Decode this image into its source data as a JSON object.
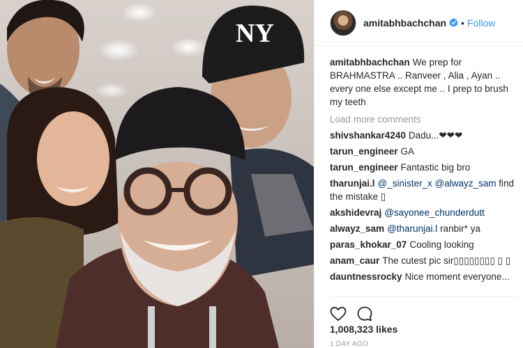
{
  "post": {
    "username": "amitabhbachchan",
    "separator": "•",
    "follow_label": "Follow",
    "caption_text": "We prep for BRAHMASTRA .. Ranveer , Alia , Ayan .. every one else except me .. I prep to brush my teeth",
    "load_more_label": "Load more comments",
    "likes": "1,008,323 likes",
    "date": "1 DAY AGO"
  },
  "comments": [
    {
      "user": "shivshankar4240",
      "text": "Dadu...❤❤❤"
    },
    {
      "user": "tarun_engineer",
      "text": "GA"
    },
    {
      "user": "tarun_engineer",
      "text": "Fantastic big bro"
    },
    {
      "user": "tharunjai.l",
      "mention": "@_sinister_x @alwayz_sam",
      "text": " find the mistake ▯"
    },
    {
      "user": "akshidevraj",
      "mention": "@sayonee_chunderdutt",
      "text": ""
    },
    {
      "user": "alwayz_sam",
      "mention": "@tharunjai.l",
      "text": " ranbir* ya"
    },
    {
      "user": "paras_khokar_07",
      "text": "Cooling looking"
    },
    {
      "user": "anam_caur",
      "text": "The cutest pic sir▯▯▯▯▯▯▯▯ ▯ ▯"
    },
    {
      "user": "dauntnessrocky",
      "text": "Nice moment everyone..."
    }
  ],
  "icons": {
    "verified": "verified-badge-icon",
    "like": "heart-outline-icon",
    "comment": "speech-bubble-icon"
  },
  "colors": {
    "link_blue": "#3897f0",
    "mention_blue": "#003569",
    "muted_gray": "#999999"
  }
}
